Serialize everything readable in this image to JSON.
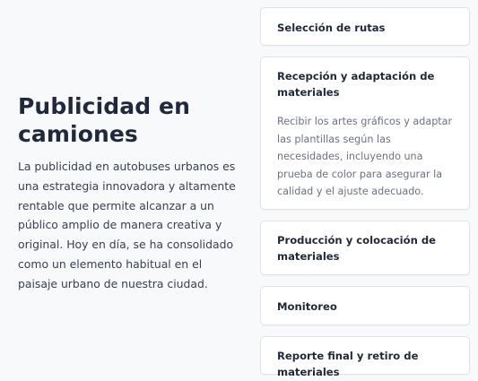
{
  "section": {
    "title": "Publicidad en camiones",
    "description": "La publicidad en autobuses urbanos es una estrategia innovadora y altamente rentable que permite alcanzar a un público amplio de manera creativa y original. Hoy en día, se ha consolidado como un elemento habitual en el paisaje urbano de nuestra ciudad."
  },
  "accordion": {
    "items": [
      {
        "title": "Selección de rutas",
        "expanded": false
      },
      {
        "title": "Recepción y adaptación de materiales",
        "expanded": true,
        "body": "Recibir los artes gráficos y adaptar las plantillas según las necesidades, incluyendo una prueba de color para asegurar la calidad y el ajuste adecuado."
      },
      {
        "title": "Producción y colocación de materiales",
        "expanded": false
      },
      {
        "title": "Monitoreo",
        "expanded": false
      },
      {
        "title": "Reporte final y retiro de materiales",
        "expanded": false
      }
    ]
  }
}
